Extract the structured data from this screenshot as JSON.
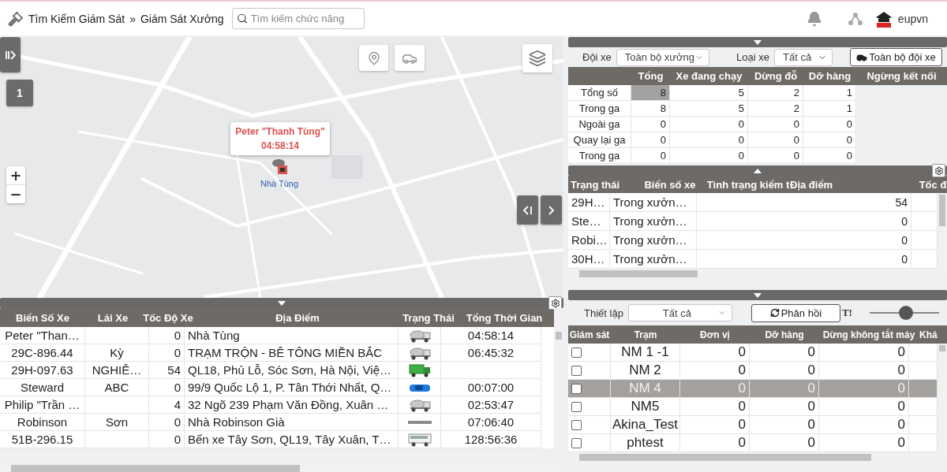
{
  "breadcrumb": [
    "Tìm Kiếm Giám Sát",
    "»",
    "Giám Sát Xưởng"
  ],
  "search": {
    "placeholder": "Tìm kiếm chức năng"
  },
  "user": {
    "name": "eupvn"
  },
  "map": {
    "cluster_count": "1",
    "popup": {
      "title": "Peter \"Thanh Tùng\"",
      "time": "04:58:14"
    },
    "marker_label": "Nhà Tùng",
    "zoom_in": "+",
    "zoom_out": "−"
  },
  "vehicle_table": {
    "columns": [
      "Biển Số Xe",
      "Lái Xe",
      "Tốc Độ Xe",
      "Địa Điểm",
      "Trạng Thái",
      "Tổng Thời Gian"
    ],
    "rows": [
      {
        "plate": "Peter \"Than…",
        "speed": "0",
        "location": "Nhà Tùng",
        "kind": "mixer",
        "duration": "04:58:14"
      },
      {
        "plate": "29C-896.44",
        "driver": "Kỳ",
        "speed": "0",
        "location": "TRẠM TRỘN - BÊ TÔNG MIỀN BẮC",
        "kind": "mixer",
        "duration": "06:45:32"
      },
      {
        "plate": "29H-097.63",
        "driver": "NGHIÊ…",
        "speed": "54",
        "location": "QL18, Phủ Lỗ, Sóc Sơn, Hà Nội, Việ…",
        "kind": "truck"
      },
      {
        "plate": "Steward",
        "driver": "ABC",
        "speed": "0",
        "location": "99/9 Quốc Lộ 1, P. Tân Thới Nhất, Q…",
        "kind": "car",
        "duration": "00:07:00"
      },
      {
        "plate": "Philip \"Trần …",
        "speed": "4",
        "location": "32 Ngõ 239 Phạm Văn Đồng, Xuân …",
        "kind": "mixer",
        "duration": "02:53:47"
      },
      {
        "plate": "Robinson",
        "driver": "Sơn",
        "speed": "0",
        "location": "Nhà Robinson Già",
        "kind": "trailer",
        "duration": "07:06:40"
      },
      {
        "plate": "51B-296.15",
        "speed": "0",
        "location": "Bến xe Tây Sơn, QL19, Tây Xuân, T…",
        "kind": "bus",
        "duration": "128:56:36"
      }
    ]
  },
  "fleet_summary": {
    "filters": [
      {
        "label": "Đội xe",
        "value": "Toàn bộ xưởng"
      },
      {
        "label": "Loại xe",
        "value": "Tất cả"
      }
    ],
    "button": "Toàn bộ đội xe",
    "columns": [
      "Tổng",
      "Xe đang chạy",
      "Dừng đỗ",
      "Dỡ hàng",
      "Ngừng kết nối"
    ],
    "rows": [
      {
        "label": "Tổng số",
        "cells": [
          {
            "value": "8",
            "selected": true
          },
          {
            "value": "5",
            "selected": false
          },
          {
            "value": "2",
            "selected": false
          },
          {
            "value": "1",
            "selected": false
          }
        ]
      },
      {
        "label": "Trong ga",
        "cells": [
          {
            "value": "8",
            "selected": false
          },
          {
            "value": "5",
            "selected": false
          },
          {
            "value": "2",
            "selected": false
          },
          {
            "value": "1",
            "selected": false
          }
        ]
      },
      {
        "label": "Ngoài ga",
        "cells": [
          {
            "value": "0",
            "selected": false
          },
          {
            "value": "0",
            "selected": false
          },
          {
            "value": "0",
            "selected": false
          },
          {
            "value": "0",
            "selected": false
          }
        ]
      },
      {
        "label": "Quay lại ga",
        "cells": [
          {
            "value": "0",
            "selected": false
          },
          {
            "value": "0",
            "selected": false
          },
          {
            "value": "0",
            "selected": false
          },
          {
            "value": "0",
            "selected": false
          }
        ]
      },
      {
        "label": "Trong ga",
        "cells": [
          {
            "value": "0",
            "selected": false
          },
          {
            "value": "0",
            "selected": false
          },
          {
            "value": "0",
            "selected": false
          },
          {
            "value": "0",
            "selected": false
          }
        ]
      }
    ]
  },
  "workshop_table": {
    "columns": [
      "Trạng thái",
      "Biển số xe",
      "Tình trạng kiểm t",
      "Địa điểm",
      "Tốc đ"
    ],
    "rows": [
      {
        "column_1": "29H…",
        "column_2": "Trong xưởn…",
        "value": "54"
      },
      {
        "column_1": "Ste…",
        "column_2": "Trong xưởn…",
        "value": "0"
      },
      {
        "column_1": "Robi…",
        "column_2": "Trong xưởn…",
        "value": "0"
      },
      {
        "column_1": "30H…",
        "column_2": "Trong xưởn…",
        "value": "0"
      }
    ]
  },
  "station_panel": {
    "filter": {
      "label": "Thiết lập",
      "value": "Tất cả"
    },
    "button": "Phản hồi",
    "marker": "T!",
    "slider": {
      "level": 0.52
    },
    "columns": [
      "Giám sát",
      "Trạm",
      "Đơn vị",
      "Dỡ hàng",
      "Dừng không tắt máy",
      "Khá"
    ],
    "rows": [
      {
        "checked": false,
        "selected": false,
        "station": "NM 1 -1",
        "values": [
          "0",
          "0",
          "0"
        ]
      },
      {
        "checked": false,
        "selected": false,
        "station": "NM 2",
        "values": [
          "0",
          "0",
          "0"
        ]
      },
      {
        "checked": false,
        "selected": true,
        "station": "NM 4",
        "values": [
          "0",
          "0",
          "0"
        ]
      },
      {
        "checked": false,
        "selected": false,
        "station": "NM5",
        "values": [
          "0",
          "0",
          "0"
        ]
      },
      {
        "checked": false,
        "selected": false,
        "station": "Akina_Test",
        "values": [
          "0",
          "0",
          "0"
        ]
      },
      {
        "checked": false,
        "selected": false,
        "station": "phtest",
        "values": [
          "0",
          "0",
          "0"
        ]
      }
    ]
  }
}
